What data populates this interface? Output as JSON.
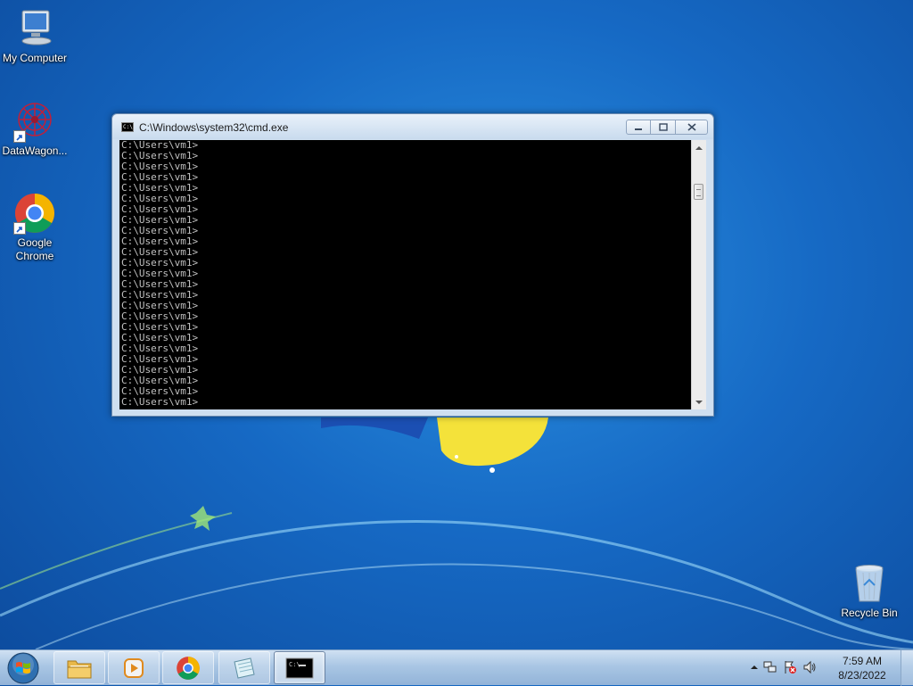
{
  "desktop": {
    "icons": [
      {
        "label": "My Computer",
        "icon": "computer-icon"
      },
      {
        "label": "DataWagon...",
        "icon": "datawagon-icon"
      },
      {
        "label": "Google Chrome",
        "icon": "chrome-icon"
      },
      {
        "label": "Recycle Bin",
        "icon": "recycle-bin-icon"
      }
    ]
  },
  "cmd_window": {
    "title": "C:\\Windows\\system32\\cmd.exe",
    "lines": [
      "C:\\Users\\vm1>",
      "C:\\Users\\vm1>",
      "C:\\Users\\vm1>",
      "C:\\Users\\vm1>",
      "C:\\Users\\vm1>",
      "C:\\Users\\vm1>",
      "C:\\Users\\vm1>",
      "C:\\Users\\vm1>",
      "C:\\Users\\vm1>",
      "C:\\Users\\vm1>",
      "C:\\Users\\vm1>",
      "C:\\Users\\vm1>",
      "C:\\Users\\vm1>",
      "C:\\Users\\vm1>",
      "C:\\Users\\vm1>",
      "C:\\Users\\vm1>",
      "C:\\Users\\vm1>",
      "C:\\Users\\vm1>",
      "C:\\Users\\vm1>",
      "C:\\Users\\vm1>",
      "C:\\Users\\vm1>",
      "C:\\Users\\vm1>",
      "C:\\Users\\vm1>",
      "C:\\Users\\vm1>",
      "C:\\Users\\vm1>"
    ]
  },
  "taskbar": {
    "items": [
      {
        "name": "start-button",
        "icon": "windows-logo-icon"
      },
      {
        "name": "explorer",
        "icon": "folder-icon"
      },
      {
        "name": "media-player",
        "icon": "media-player-icon"
      },
      {
        "name": "chrome",
        "icon": "chrome-icon"
      },
      {
        "name": "notepad",
        "icon": "notepad-icon"
      },
      {
        "name": "cmd",
        "icon": "console-icon",
        "active": true
      }
    ],
    "clock": {
      "time": "7:59 AM",
      "date": "8/23/2022"
    }
  },
  "colors": {
    "console_bg": "#000000",
    "console_fg": "#c0c0c0",
    "desktop_blue": "#1669c4"
  }
}
